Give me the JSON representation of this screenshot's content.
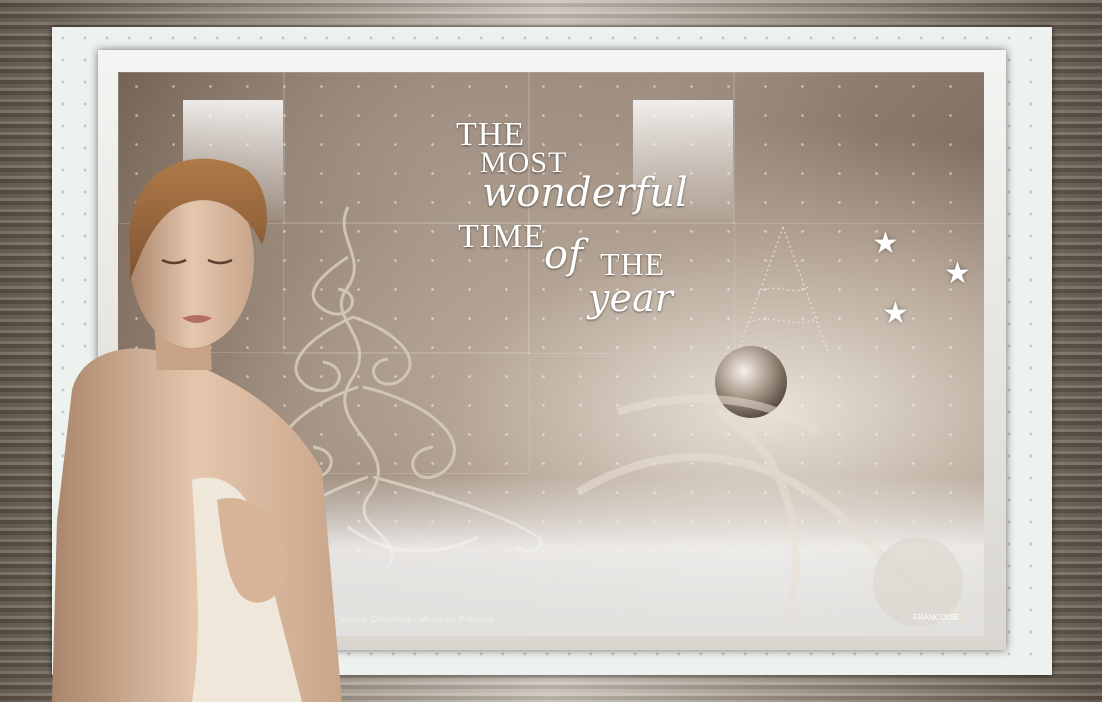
{
  "title": {
    "line1": "THE",
    "line2": "MOST",
    "line3": "wonderful",
    "line4": "TIME",
    "line5": "of",
    "line6": "THE",
    "line7": "year"
  },
  "signature": "FRANCOISE",
  "credit_text": "tutorial Christmas - Moments Précieux",
  "palette": {
    "sepia_dark": "#5e4f44",
    "sepia_light": "#c9bcae",
    "frame": "#eef2ef"
  }
}
